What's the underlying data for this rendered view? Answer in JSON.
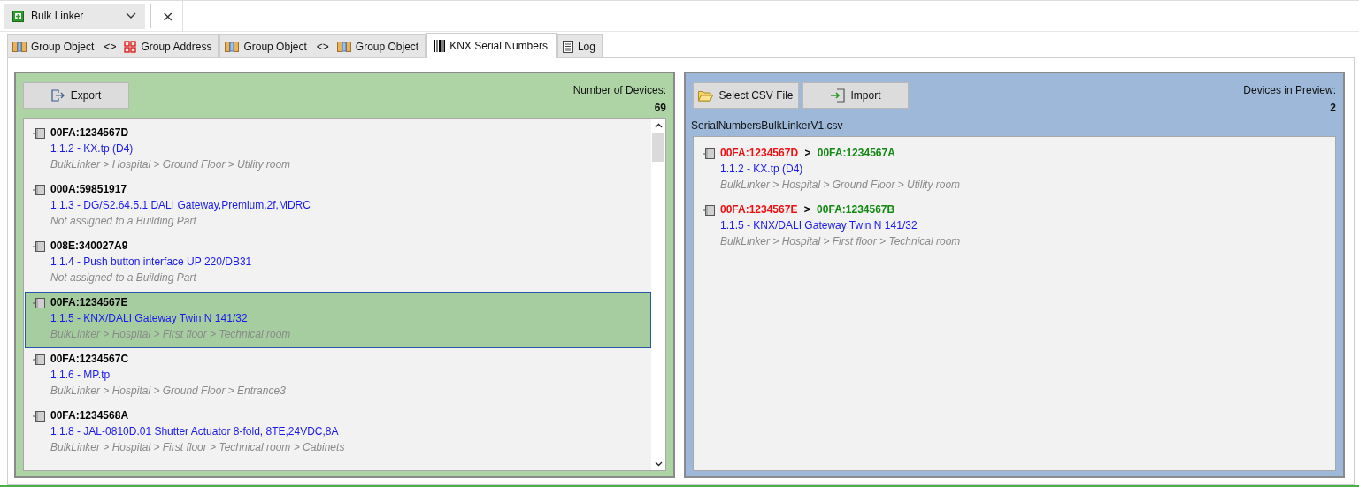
{
  "document_selector": {
    "title": "Bulk Linker",
    "close_label": "×"
  },
  "tabs": [
    {
      "selected": false,
      "parts": [
        {
          "kind": "object",
          "label": "Group Object"
        },
        {
          "kind": "text",
          "label": "<>"
        },
        {
          "kind": "address",
          "label": "Group Address"
        }
      ]
    },
    {
      "selected": false,
      "parts": [
        {
          "kind": "object",
          "label": "Group Object"
        },
        {
          "kind": "text",
          "label": "<>"
        },
        {
          "kind": "object",
          "label": "Group Object"
        }
      ]
    },
    {
      "selected": true,
      "parts": [
        {
          "kind": "barcode",
          "label": "KNX Serial Numbers"
        }
      ]
    },
    {
      "selected": false,
      "parts": [
        {
          "kind": "log",
          "label": "Log"
        }
      ]
    }
  ],
  "devices_panel": {
    "export_button": "Export",
    "count_label": "Number of Devices:",
    "count": "69",
    "devices": [
      {
        "serial": "00FA:1234567D",
        "type": "1.1.2 - KX.tp (D4)",
        "location": "BulkLinker > Hospital > Ground Floor > Utility room",
        "selected": false
      },
      {
        "serial": "000A:59851917",
        "type": "1.1.3 - DG/S2.64.5.1 DALI Gateway,Premium,2f,MDRC",
        "location": "Not assigned to a Building Part",
        "selected": false
      },
      {
        "serial": "008E:340027A9",
        "type": "1.1.4 - Push button interface UP 220/DB31",
        "location": "Not assigned to a Building Part",
        "selected": false
      },
      {
        "serial": "00FA:1234567E",
        "type": "1.1.5 - KNX/DALI Gateway Twin N 141/32",
        "location": "BulkLinker > Hospital > First floor > Technical room",
        "selected": true
      },
      {
        "serial": "00FA:1234567C",
        "type": "1.1.6 - MP.tp",
        "location": "BulkLinker > Hospital > Ground Floor > Entrance3",
        "selected": false
      },
      {
        "serial": "00FA:1234568A",
        "type": "1.1.8 - JAL-0810D.01 Shutter Actuator 8-fold, 8TE,24VDC,8A",
        "location": "BulkLinker > Hospital > First floor > Technical room > Cabinets",
        "selected": false
      }
    ]
  },
  "preview_panel": {
    "select_button": "Select CSV File",
    "import_button": "Import",
    "count_label": "Devices in Preview:",
    "count": "2",
    "file_name": "SerialNumbersBulkLinkerV1.csv",
    "changes": [
      {
        "old_serial": "00FA:1234567D",
        "arrow": ">",
        "new_serial": "00FA:1234567A",
        "type": "1.1.2  -  KX.tp (D4)",
        "location": "BulkLinker > Hospital > Ground Floor > Utility room"
      },
      {
        "old_serial": "00FA:1234567E",
        "arrow": ">",
        "new_serial": "00FA:1234567B",
        "type": "1.1.5  -  KNX/DALI Gateway Twin N 141/32",
        "location": "BulkLinker > Hospital > First floor > Technical room"
      }
    ]
  }
}
